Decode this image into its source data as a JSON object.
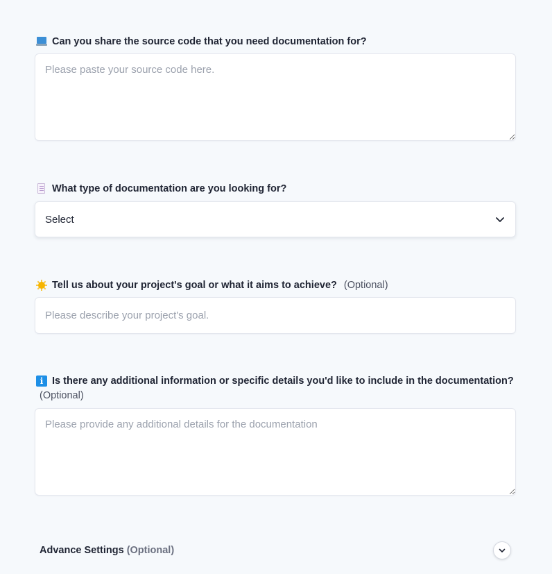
{
  "fields": {
    "source_code": {
      "label": "Can you share the source code that you need documentation for?",
      "icon": "laptop-icon",
      "placeholder": "Please paste your source code here.",
      "value": ""
    },
    "doc_type": {
      "label": "What type of documentation are you looking for?",
      "icon": "document-icon",
      "selected": "Select"
    },
    "project_goal": {
      "label": "Tell us about your project's goal or what it aims to achieve?",
      "optional": "(Optional)",
      "icon": "sun-icon",
      "placeholder": "Please describe your project's goal.",
      "value": ""
    },
    "additional_info": {
      "label": "Is there any additional information or specific details you'd like to include in the documentation?",
      "optional": "(Optional)",
      "icon": "info-icon",
      "placeholder": "Please provide any additional details for the documentation",
      "value": ""
    }
  },
  "advance_settings": {
    "label": "Advance Settings",
    "optional": "(Optional)",
    "toggle_icon": "chevron-down-icon"
  },
  "colors": {
    "background": "#f6f9fc",
    "text": "#1f2433",
    "placeholder": "#9ba1ad",
    "border": "#e4e7ee"
  }
}
